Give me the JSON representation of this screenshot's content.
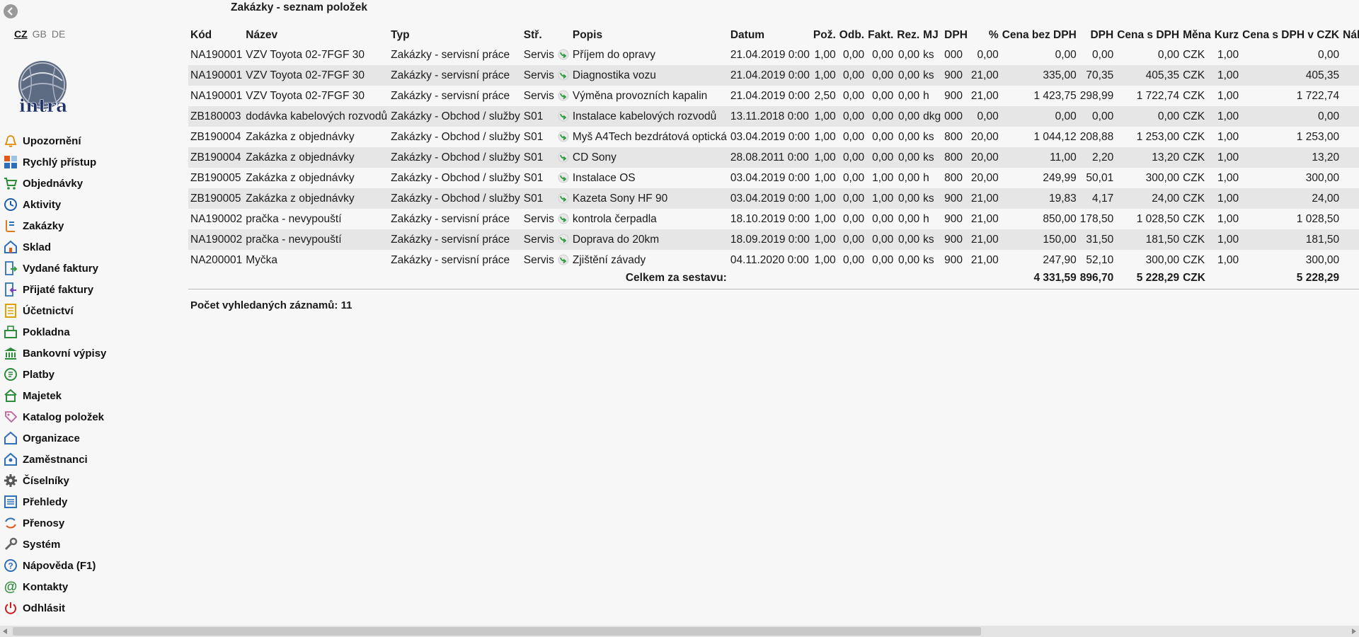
{
  "lang": {
    "items": [
      "CZ",
      "GB",
      "DE"
    ],
    "active": "CZ"
  },
  "logo": {
    "text": "intra"
  },
  "nav": [
    {
      "label": "Upozornění",
      "icon": "bell-icon"
    },
    {
      "label": "Rychlý přístup",
      "icon": "quick-access-icon"
    },
    {
      "label": "Objednávky",
      "icon": "cart-icon"
    },
    {
      "label": "Aktivity",
      "icon": "clock-icon"
    },
    {
      "label": "Zakázky",
      "icon": "orders-icon"
    },
    {
      "label": "Sklad",
      "icon": "warehouse-icon"
    },
    {
      "label": "Vydané faktury",
      "icon": "invoice-out-icon"
    },
    {
      "label": "Přijaté faktury",
      "icon": "invoice-in-icon"
    },
    {
      "label": "Účetnictví",
      "icon": "ledger-icon"
    },
    {
      "label": "Pokladna",
      "icon": "cashbox-icon"
    },
    {
      "label": "Bankovní výpisy",
      "icon": "bank-icon"
    },
    {
      "label": "Platby",
      "icon": "payments-icon"
    },
    {
      "label": "Majetek",
      "icon": "assets-icon"
    },
    {
      "label": "Katalog položek",
      "icon": "tag-icon"
    },
    {
      "label": "Organizace",
      "icon": "organization-icon"
    },
    {
      "label": "Zaměstnanci",
      "icon": "employees-icon"
    },
    {
      "label": "Číselníky",
      "icon": "gear-icon"
    },
    {
      "label": "Přehledy",
      "icon": "list-icon"
    },
    {
      "label": "Přenosy",
      "icon": "sync-icon"
    },
    {
      "label": "Systém",
      "icon": "wrench-icon"
    },
    {
      "label": "Nápověda (F1)",
      "icon": "help-icon"
    },
    {
      "label": "Kontakty",
      "icon": "at-icon"
    },
    {
      "label": "Odhlásit",
      "icon": "power-icon"
    }
  ],
  "page": {
    "title": "Zakázky - seznam položek"
  },
  "table": {
    "columns": [
      "Kód",
      "Název",
      "Typ",
      "Stř.",
      "",
      "Popis",
      "Datum",
      "Pož.",
      "Odb.",
      "Fakt.",
      "Rez.",
      "MJ",
      "DPH",
      "%",
      "Cena bez DPH",
      "DPH",
      "Cena s DPH",
      "Měna",
      "Kurz",
      "Cena s DPH v CZK",
      "Náklady"
    ],
    "rows": [
      [
        "NA190001",
        "VZV Toyota 02-7FGF 30",
        "Zakázky - servisní práce",
        "Servis",
        "Příjem do opravy",
        "21.04.2019 0:00",
        "1,00",
        "0,00",
        "0,00",
        "0,00",
        "ks",
        "000",
        "0,00",
        "0,00",
        "0,00",
        "0,00",
        "CZK",
        "1,00",
        "0,00",
        ""
      ],
      [
        "NA190001",
        "VZV Toyota 02-7FGF 30",
        "Zakázky - servisní práce",
        "Servis",
        "Diagnostika vozu",
        "21.04.2019 0:00",
        "1,00",
        "0,00",
        "0,00",
        "0,00",
        "ks",
        "900",
        "21,00",
        "335,00",
        "70,35",
        "405,35",
        "CZK",
        "1,00",
        "405,35",
        ""
      ],
      [
        "NA190001",
        "VZV Toyota 02-7FGF 30",
        "Zakázky - servisní práce",
        "Servis",
        "Výměna provozních kapalin",
        "21.04.2019 0:00",
        "2,50",
        "0,00",
        "0,00",
        "0,00",
        "h",
        "900",
        "21,00",
        "1 423,75",
        "298,99",
        "1 722,74",
        "CZK",
        "1,00",
        "1 722,74",
        ""
      ],
      [
        "ZB180003",
        "dodávka kabelových rozvodů",
        "Zakázky - Obchod / služby",
        "S01",
        "Instalace kabelových rozvodů",
        "13.11.2018 0:00",
        "1,00",
        "0,00",
        "0,00",
        "0,00",
        "dkg",
        "000",
        "0,00",
        "0,00",
        "0,00",
        "0,00",
        "CZK",
        "1,00",
        "0,00",
        ""
      ],
      [
        "ZB190004",
        "Zakázka z objednávky",
        "Zakázky - Obchod / služby",
        "S01",
        "Myš A4Tech bezdrátová optická",
        "03.04.2019 0:00",
        "1,00",
        "0,00",
        "0,00",
        "0,00",
        "ks",
        "800",
        "20,00",
        "1 044,12",
        "208,88",
        "1 253,00",
        "CZK",
        "1,00",
        "1 253,00",
        ""
      ],
      [
        "ZB190004",
        "Zakázka z objednávky",
        "Zakázky - Obchod / služby",
        "S01",
        "CD Sony",
        "28.08.2011 0:00",
        "1,00",
        "0,00",
        "0,00",
        "0,00",
        "ks",
        "800",
        "20,00",
        "11,00",
        "2,20",
        "13,20",
        "CZK",
        "1,00",
        "13,20",
        ""
      ],
      [
        "ZB190005",
        "Zakázka z objednávky",
        "Zakázky - Obchod / služby",
        "S01",
        "Instalace OS",
        "03.04.2019 0:00",
        "1,00",
        "0,00",
        "1,00",
        "0,00",
        "h",
        "800",
        "20,00",
        "249,99",
        "50,01",
        "300,00",
        "CZK",
        "1,00",
        "300,00",
        ""
      ],
      [
        "ZB190005",
        "Zakázka z objednávky",
        "Zakázky - Obchod / služby",
        "S01",
        "Kazeta Sony HF 90",
        "03.04.2019 0:00",
        "1,00",
        "0,00",
        "1,00",
        "0,00",
        "ks",
        "900",
        "21,00",
        "19,83",
        "4,17",
        "24,00",
        "CZK",
        "1,00",
        "24,00",
        ""
      ],
      [
        "NA190002",
        "pračka - nevypouští",
        "Zakázky - servisní práce",
        "Servis",
        "kontrola čerpadla",
        "18.10.2019 0:00",
        "1,00",
        "0,00",
        "0,00",
        "0,00",
        "h",
        "900",
        "21,00",
        "850,00",
        "178,50",
        "1 028,50",
        "CZK",
        "1,00",
        "1 028,50",
        ""
      ],
      [
        "NA190002",
        "pračka - nevypouští",
        "Zakázky - servisní práce",
        "Servis",
        "Doprava do 20km",
        "18.09.2019 0:00",
        "1,00",
        "0,00",
        "0,00",
        "0,00",
        "ks",
        "900",
        "21,00",
        "150,00",
        "31,50",
        "181,50",
        "CZK",
        "1,00",
        "181,50",
        ""
      ],
      [
        "NA200001",
        "Myčka",
        "Zakázky - servisní práce",
        "Servis",
        "Zjištění závady",
        "04.11.2020 0:00",
        "1,00",
        "0,00",
        "0,00",
        "0,00",
        "ks",
        "900",
        "21,00",
        "247,90",
        "52,10",
        "300,00",
        "CZK",
        "1,00",
        "300,00",
        ""
      ]
    ],
    "total": {
      "label": "Celkem za sestavu:",
      "cena_bez_dph": "4 331,59",
      "dph": "896,70",
      "cena_s_dph": "5 228,29",
      "mena": "CZK",
      "cena_czk": "5 228,29"
    }
  },
  "count": {
    "text": "Počet vyhledaných záznamů: 11"
  },
  "colors": {
    "accent_green": "#2e9e3f",
    "row_alt": "#e6e6e6",
    "bg": "#f7f7f7"
  }
}
